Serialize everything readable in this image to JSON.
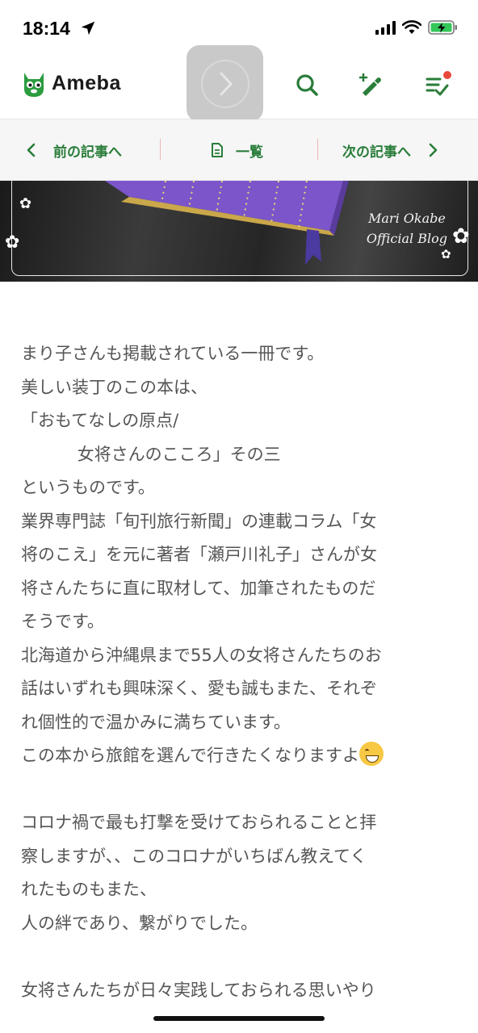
{
  "status_bar": {
    "time": "18:14"
  },
  "header": {
    "logo_text": "Ameba"
  },
  "article_nav": {
    "prev_label": "前の記事へ",
    "list_label": "一覧",
    "next_label": "次の記事へ"
  },
  "banner": {
    "line1": "Mari Okabe",
    "line2": "Official Blog"
  },
  "article": {
    "lines": [
      "まり子さんも掲載されている一冊です。",
      "美しい装丁のこの本は、",
      "「おもてなしの原点/",
      "　　　 女将さんのこころ」その三",
      "というものです。",
      "業界専門誌「旬刊旅行新聞」の連載コラム「女",
      "将のこえ」を元に著者「瀬戸川礼子」さんが女",
      "将さんたちに直に取材して、加筆されたものだ",
      "そうです。",
      "北海道から沖縄県まで55人の女将さんたちのお",
      "話はいずれも興味深く、愛も誠もまた、それぞ",
      "れ個性的で温かみに満ちています。",
      "この本から旅館を選んで行きたくなりますよ",
      "",
      "コロナ禍で最も打撃を受けておられることと拝",
      "察しますが、、このコロナがいちばん教えてく",
      "れたものもまた、",
      "人の絆であり、繋がりでした。",
      "",
      "女将さんたちが日々実践しておられる思いやり"
    ]
  },
  "colors": {
    "brand_green": "#2a7d3a",
    "notification_red": "#e8483a"
  }
}
